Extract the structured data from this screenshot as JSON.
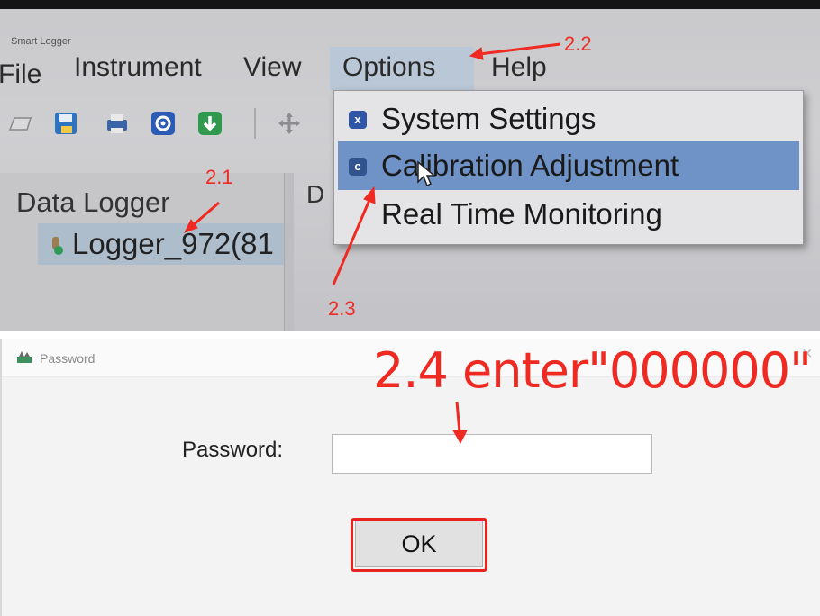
{
  "app": {
    "title": "Smart Logger"
  },
  "menubar": [
    "File",
    "Instrument",
    "View",
    "Options",
    "Help"
  ],
  "toolbar": {
    "icons": [
      "open-icon",
      "save-icon",
      "print-icon",
      "settings-icon",
      "download-icon",
      "move-icon"
    ]
  },
  "sidebar": {
    "title": "Data Logger",
    "item": "Logger_972(81"
  },
  "content": {
    "header_fragment": "D"
  },
  "options_menu": {
    "items": [
      {
        "icon": "x",
        "label": "System Settings"
      },
      {
        "icon": "c",
        "label": "Calibration Adjustment"
      },
      {
        "icon": "",
        "label": "Real Time Monitoring"
      }
    ],
    "highlighted_index": 1
  },
  "dialog": {
    "title": "Password",
    "close": "×",
    "field_label": "Password:",
    "field_value": "",
    "ok_label": "OK"
  },
  "annotations": {
    "step_21": "2.1",
    "step_22": "2.2",
    "step_23": "2.3",
    "step_24": "2.4 enter\"000000\"",
    "color": "#ee2a22"
  },
  "colors": {
    "menu_highlight": "#6f93c7",
    "annotation_red": "#ee2a22"
  }
}
